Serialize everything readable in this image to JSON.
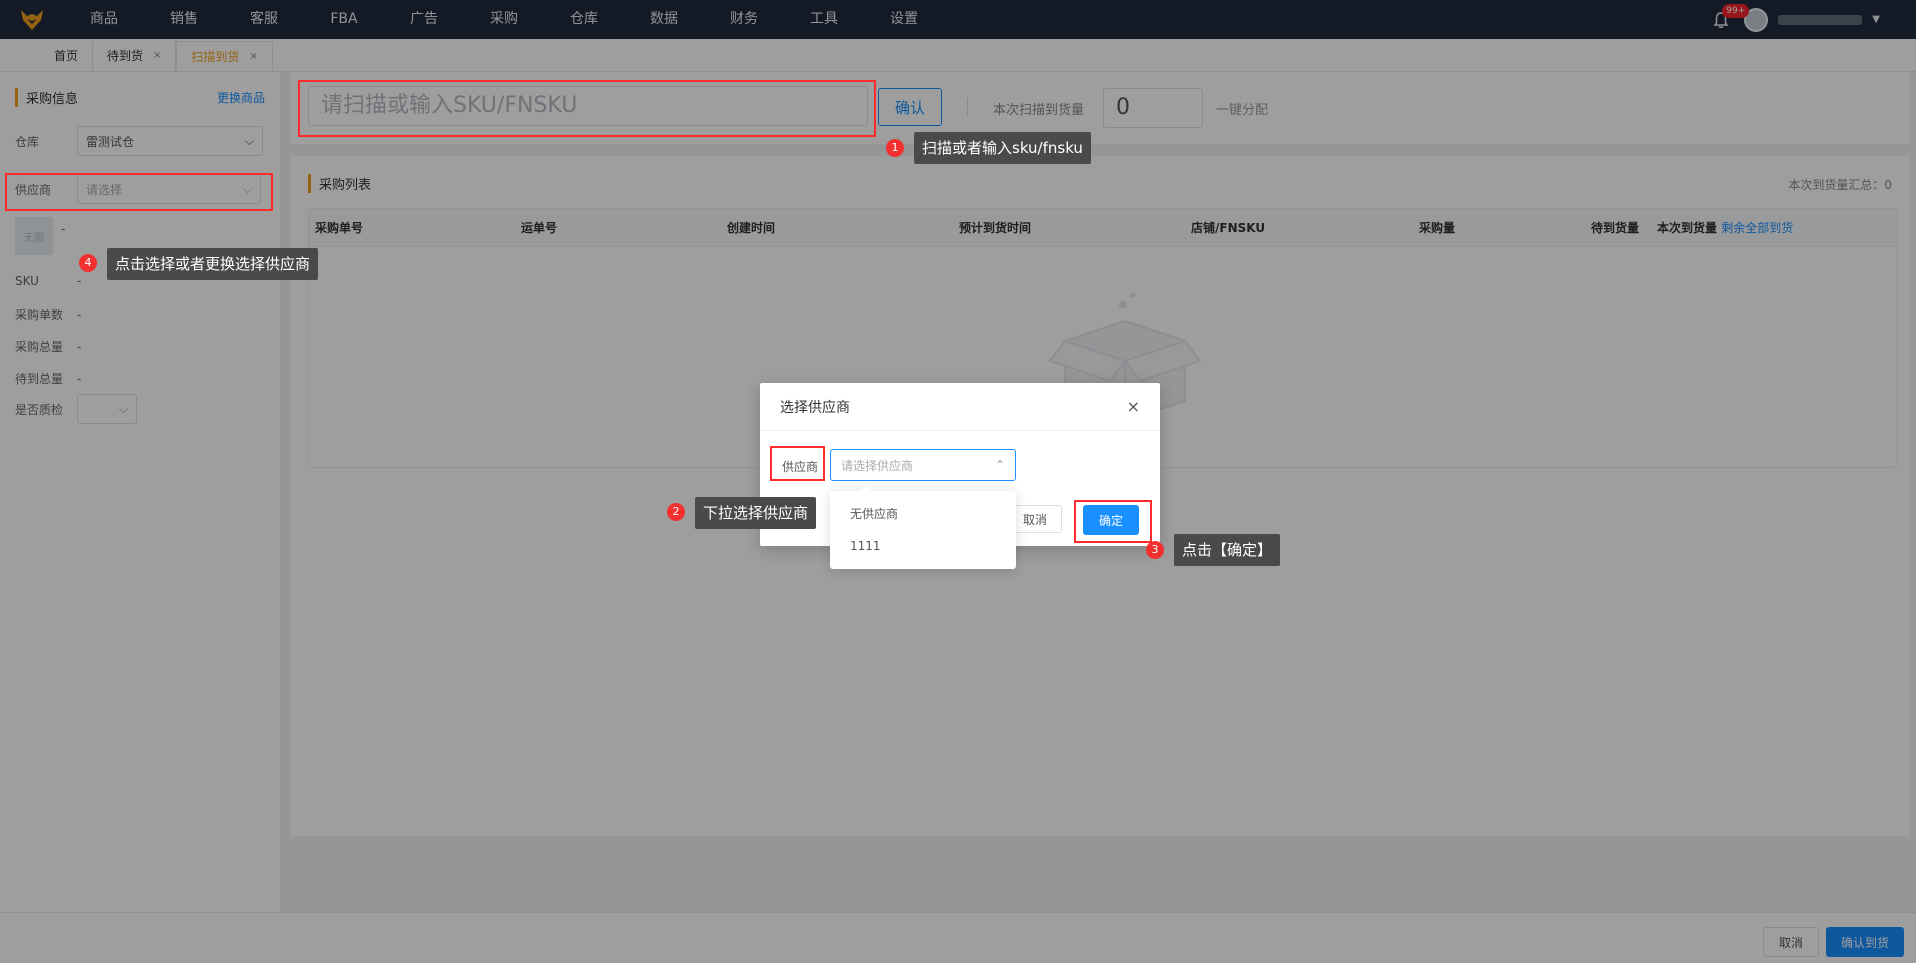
{
  "nav": {
    "items": [
      "商品",
      "销售",
      "客服",
      "FBA",
      "广告",
      "采购",
      "仓库",
      "数据",
      "财务",
      "工具",
      "设置"
    ],
    "notification_badge": "99+"
  },
  "tabs": [
    {
      "label": "首页"
    },
    {
      "label": "待到货",
      "close": "×"
    },
    {
      "label": "扫描到货",
      "close": "×"
    }
  ],
  "left": {
    "title": "采购信息",
    "change_link": "更换商品",
    "warehouse_label": "仓库",
    "warehouse_value": "雷测试仓",
    "supplier_label": "供应商",
    "supplier_placeholder": "请选择",
    "image_placeholder": "无图",
    "image_dash": "-",
    "sku_label": "SKU",
    "sku_value": "-",
    "order_count_label": "采购单数",
    "order_count_value": "-",
    "total_label": "采购总量",
    "total_value": "-",
    "pending_label": "待到总量",
    "pending_value": "-",
    "qc_label": "是否质检"
  },
  "scan": {
    "placeholder": "请扫描或输入SKU/FNSKU",
    "confirm": "确认",
    "qty_label": "本次扫描到货量",
    "qty_value": "0",
    "one_click": "一键分配"
  },
  "list": {
    "title": "采购列表",
    "summary": "本次到货量汇总：0",
    "columns": [
      "采购单号",
      "运单号",
      "创建时间",
      "预计到货时间",
      "店铺/FNSKU",
      "采购量",
      "待到货量",
      "本次到货量"
    ],
    "fill_all_link": "剩余全部到货"
  },
  "footer": {
    "cancel": "取消",
    "confirm": "确认到货"
  },
  "modal": {
    "title": "选择供应商",
    "close": "×",
    "label": "供应商",
    "placeholder": "请选择供应商",
    "options": [
      "无供应商",
      "1111"
    ],
    "cancel": "取消",
    "ok": "确定"
  },
  "annotations": [
    {
      "num": "1",
      "text": "扫描或者输入sku/fnsku"
    },
    {
      "num": "2",
      "text": "下拉选择供应商"
    },
    {
      "num": "3",
      "text": "点击【确定】"
    },
    {
      "num": "4",
      "text": "点击选择或者更换选择供应商"
    }
  ],
  "colors": {
    "primary": "#1890ff",
    "accent": "#f0a020",
    "topbar": "#1f2a3d",
    "highlight": "#ff2a2a"
  }
}
